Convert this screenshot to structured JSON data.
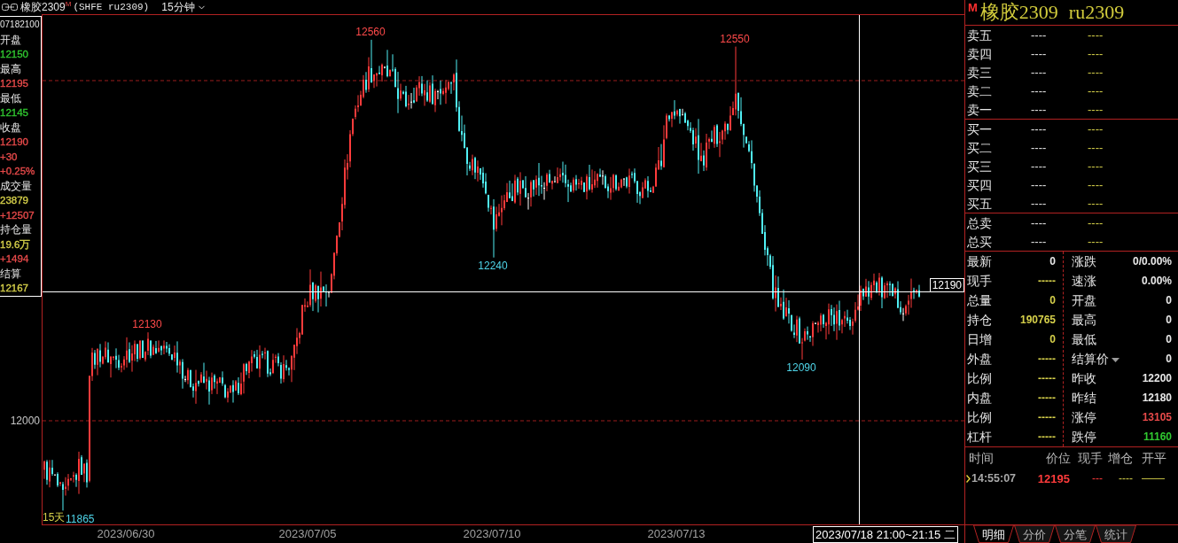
{
  "title_bar": {
    "symbol": "橡胶2309",
    "market_flag": "M",
    "exchange_code": "(SHFE ru2309)",
    "period": "15分钟"
  },
  "info_panel": {
    "timestamp": "07182100",
    "fields": [
      {
        "label": "开盘",
        "values": [
          {
            "text": "12150",
            "color": "#30c830"
          }
        ]
      },
      {
        "label": "最高",
        "values": [
          {
            "text": "12195",
            "color": "#e84a4a"
          }
        ]
      },
      {
        "label": "最低",
        "values": [
          {
            "text": "12145",
            "color": "#30c830"
          }
        ]
      },
      {
        "label": "收盘",
        "values": [
          {
            "text": "12190",
            "color": "#e84a4a"
          },
          {
            "text": "+30",
            "color": "#e84a4a"
          },
          {
            "text": "+0.25%",
            "color": "#e84a4a"
          }
        ]
      },
      {
        "label": "成交量",
        "values": [
          {
            "text": "23879",
            "color": "#d6d04a"
          },
          {
            "text": "+12507",
            "color": "#e84a4a"
          }
        ]
      },
      {
        "label": "持仓量",
        "values": [
          {
            "text": "19.6万",
            "color": "#d6d04a"
          },
          {
            "text": "+1494",
            "color": "#e84a4a"
          }
        ]
      },
      {
        "label": "结算",
        "values": [
          {
            "text": "12167",
            "color": "#d6d04a"
          }
        ]
      }
    ]
  },
  "chart": {
    "y_axis_labels": [
      "12000"
    ],
    "extreme_labels": [
      {
        "text": "12560",
        "kind": "high"
      },
      {
        "text": "12550",
        "kind": "high"
      },
      {
        "text": "12240",
        "kind": "low"
      },
      {
        "text": "12130",
        "kind": "high"
      },
      {
        "text": "12090",
        "kind": "low"
      },
      {
        "text": "11865",
        "kind": "low"
      }
    ],
    "period_label": "15天",
    "crosshair": {
      "price": "12190",
      "time": "2023/07/18 21:00~21:15 二"
    },
    "x_axis_labels": [
      "2023/06/30",
      "2023/07/05",
      "2023/07/10",
      "2023/07/13"
    ]
  },
  "quote_header": {
    "market_flag": "M",
    "name": "橡胶2309",
    "code": "ru2309"
  },
  "order_book": {
    "asks": [
      {
        "label": "卖五",
        "price": "----",
        "volume": "----"
      },
      {
        "label": "卖四",
        "price": "----",
        "volume": "----"
      },
      {
        "label": "卖三",
        "price": "----",
        "volume": "----"
      },
      {
        "label": "卖二",
        "price": "----",
        "volume": "----"
      },
      {
        "label": "卖一",
        "price": "----",
        "volume": "----"
      }
    ],
    "bids": [
      {
        "label": "买一",
        "price": "----",
        "volume": "----"
      },
      {
        "label": "买二",
        "price": "----",
        "volume": "----"
      },
      {
        "label": "买三",
        "price": "----",
        "volume": "----"
      },
      {
        "label": "买四",
        "price": "----",
        "volume": "----"
      },
      {
        "label": "买五",
        "price": "----",
        "volume": "----"
      }
    ],
    "totals": [
      {
        "label": "总卖",
        "price": "----",
        "volume": "----"
      },
      {
        "label": "总买",
        "price": "----",
        "volume": "----"
      }
    ]
  },
  "quote_stats": {
    "left": [
      {
        "label": "最新",
        "value": "0",
        "color": "#e8e8e8"
      },
      {
        "label": "现手",
        "value": "-----",
        "color": "#d6d04a"
      },
      {
        "label": "总量",
        "value": "0",
        "color": "#d6d04a"
      },
      {
        "label": "持仓",
        "value": "190765",
        "color": "#d6d04a"
      },
      {
        "label": "日增",
        "value": "0",
        "color": "#d6d04a"
      },
      {
        "label": "外盘",
        "value": "-----",
        "color": "#d6d04a"
      },
      {
        "label": "比例",
        "value": "-----",
        "color": "#d6d04a"
      },
      {
        "label": "内盘",
        "value": "-----",
        "color": "#d6d04a"
      },
      {
        "label": "比例",
        "value": "-----",
        "color": "#d6d04a"
      },
      {
        "label": "杠杆",
        "value": "-----",
        "color": "#d6d04a"
      }
    ],
    "right": [
      {
        "label": "涨跌",
        "value": "0/0.00%",
        "color": "#e8e8e8",
        "kind": "plain"
      },
      {
        "label": "速涨",
        "value": "0.00%",
        "color": "#e8e8e8",
        "kind": "plain"
      },
      {
        "label": "开盘",
        "value": "0",
        "color": "#e8e8e8",
        "kind": "plain"
      },
      {
        "label": "最高",
        "value": "0",
        "color": "#e8e8e8",
        "kind": "plain"
      },
      {
        "label": "最低",
        "value": "0",
        "color": "#e8e8e8",
        "kind": "plain"
      },
      {
        "label": "结算价",
        "value": "0",
        "color": "#e8e8e8",
        "kind": "dropdown"
      },
      {
        "label": "昨收",
        "value": "12200",
        "color": "#e8e8e8",
        "kind": "plain"
      },
      {
        "label": "昨结",
        "value": "12180",
        "color": "#e8e8e8",
        "kind": "plain"
      },
      {
        "label": "涨停",
        "value": "13105",
        "color": "#e84a4a",
        "kind": "plain"
      },
      {
        "label": "跌停",
        "value": "11160",
        "color": "#30c830",
        "kind": "plain"
      }
    ]
  },
  "trades": {
    "columns": [
      "时间",
      "价位",
      "现手",
      "增仓",
      "开平"
    ],
    "rows": [
      {
        "time": "14:55:07",
        "price": "12195",
        "volume": "---",
        "oi_change": "----",
        "open_close": "——",
        "selected": true
      }
    ]
  },
  "detail_tabs": [
    {
      "label": "明细",
      "selected": true
    },
    {
      "label": "分价",
      "selected": false
    },
    {
      "label": "分笔",
      "selected": false
    },
    {
      "label": "统计",
      "selected": false
    }
  ]
}
